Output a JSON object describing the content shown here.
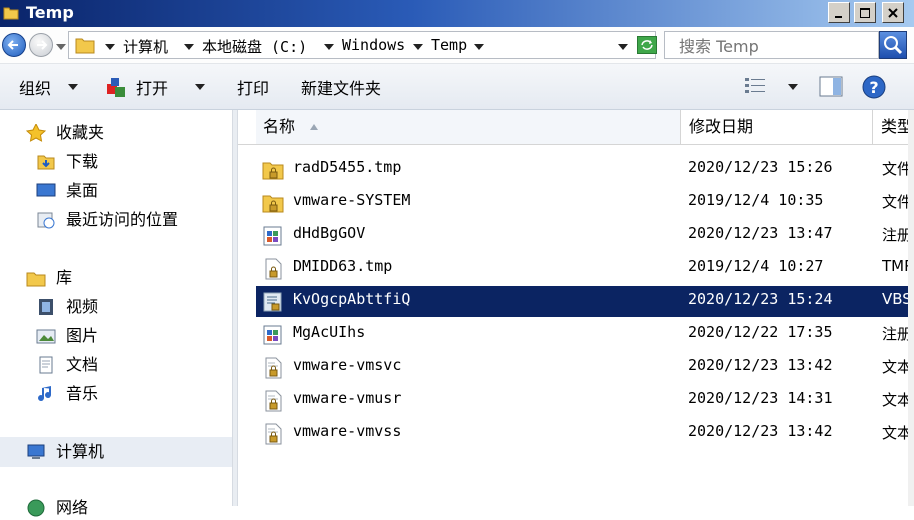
{
  "window": {
    "title": "Temp"
  },
  "address": {
    "crumbs": [
      "计算机",
      "本地磁盘 (C:)",
      "Windows",
      "Temp"
    ]
  },
  "search": {
    "placeholder": "搜索 Temp"
  },
  "toolbar": {
    "organize": "组织",
    "open": "打开",
    "print": "打印",
    "new_folder": "新建文件夹"
  },
  "sidebar": {
    "favorites": {
      "label": "收藏夹",
      "items": [
        "下载",
        "桌面",
        "最近访问的位置"
      ]
    },
    "libraries": {
      "label": "库",
      "items": [
        "视频",
        "图片",
        "文档",
        "音乐"
      ]
    },
    "computer": "计算机",
    "network": "网络"
  },
  "columns": {
    "name": "名称",
    "modified": "修改日期",
    "type": "类型"
  },
  "files": [
    {
      "name": "radD5455.tmp",
      "modified": "2020/12/23 15:26",
      "type": "文件",
      "icon": "folder-lock-icon"
    },
    {
      "name": "vmware-SYSTEM",
      "modified": "2019/12/4 10:35",
      "type": "文件",
      "icon": "folder-lock-icon"
    },
    {
      "name": "dHdBgGOV",
      "modified": "2020/12/23 13:47",
      "type": "注册",
      "icon": "registry-file-icon"
    },
    {
      "name": "DMIDD63.tmp",
      "modified": "2019/12/4 10:27",
      "type": "TMP",
      "icon": "blank-file-lock-icon"
    },
    {
      "name": "KvOgcpAbttfiQ",
      "modified": "2020/12/23 15:24",
      "type": "VBS",
      "icon": "script-file-icon",
      "selected": true
    },
    {
      "name": "MgAcUIhs",
      "modified": "2020/12/22 17:35",
      "type": "注册",
      "icon": "registry-file-icon"
    },
    {
      "name": "vmware-vmsvc",
      "modified": "2020/12/23 13:42",
      "type": "文本",
      "icon": "text-file-lock-icon"
    },
    {
      "name": "vmware-vmusr",
      "modified": "2020/12/23 14:31",
      "type": "文本",
      "icon": "text-file-lock-icon"
    },
    {
      "name": "vmware-vmvss",
      "modified": "2020/12/23 13:42",
      "type": "文本",
      "icon": "text-file-lock-icon"
    }
  ],
  "colors": {
    "title_start": "#0a246a",
    "selection": "#0b2462",
    "accent": "#2a5bb7"
  }
}
